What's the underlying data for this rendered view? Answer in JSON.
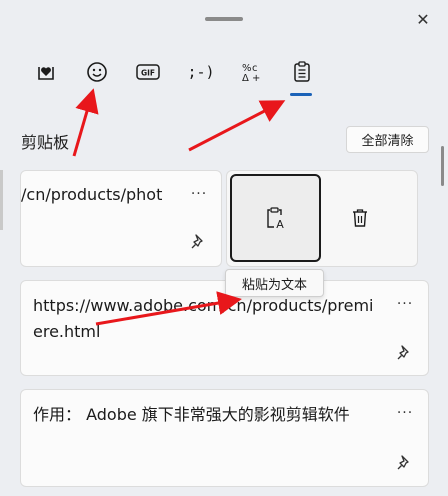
{
  "panel": {
    "close_glyph": "✕"
  },
  "toolbar": {
    "tabs": [
      {
        "name": "favorites",
        "icon": "heart-box-icon"
      },
      {
        "name": "emoji",
        "icon": "smiley-icon"
      },
      {
        "name": "gif",
        "icon": "gif-icon",
        "label": "GIF"
      },
      {
        "name": "kaomoji",
        "icon": "kaomoji-icon",
        "label": ";-)"
      },
      {
        "name": "symbols",
        "icon": "symbols-icon"
      },
      {
        "name": "clipboard",
        "icon": "clipboard-icon",
        "selected": true
      }
    ],
    "accent": "#1b62b8"
  },
  "clipboard": {
    "title": "剪贴板",
    "clear_all_label": "全部清除",
    "items": [
      {
        "text": "/cn/products/phot",
        "more": "···"
      },
      {
        "text": "https://www.adobe.com/cn/products/premiere.html",
        "more": "···"
      },
      {
        "text": "作用： Adobe 旗下非常强大的影视剪辑软件",
        "more": "···"
      }
    ],
    "paste_as_text_tooltip": "粘贴为文本"
  },
  "annotations": {
    "arrow_color": "#e8171b"
  }
}
